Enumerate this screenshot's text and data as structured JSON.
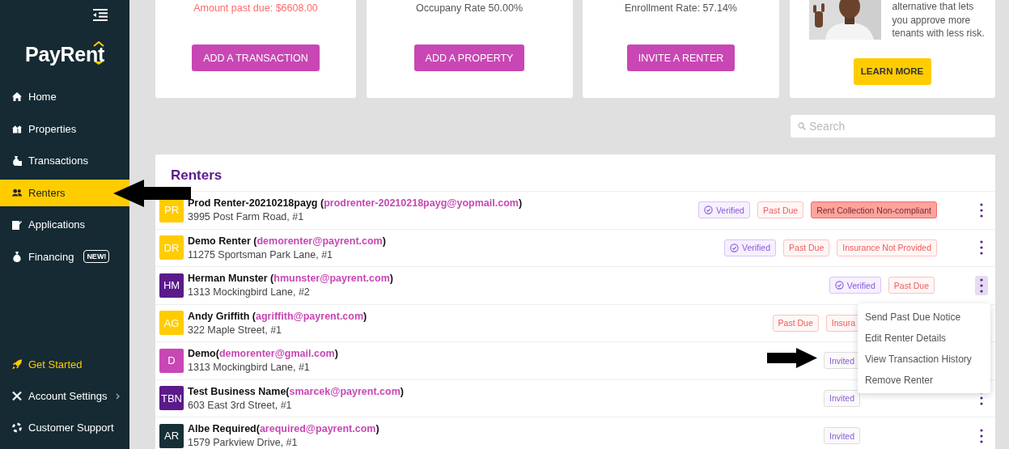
{
  "sidebar": {
    "logo": "PayRent",
    "items": [
      {
        "label": "Home",
        "selected": false
      },
      {
        "label": "Properties",
        "selected": false
      },
      {
        "label": "Transactions",
        "selected": false
      },
      {
        "label": "Renters",
        "selected": true
      },
      {
        "label": "Applications",
        "selected": false
      },
      {
        "label": "Financing",
        "selected": false,
        "badge": "NEW!"
      }
    ],
    "bottom_items": [
      {
        "label": "Get Started",
        "kind": "accent"
      },
      {
        "label": "Account Settings",
        "kind": "submenu"
      },
      {
        "label": "Customer Support",
        "kind": "plain"
      }
    ]
  },
  "cards": [
    {
      "kind": "stat",
      "text": "Amount past due: $6608.00",
      "alert": true,
      "button": "ADD A TRANSACTION"
    },
    {
      "kind": "stat",
      "text": "Occupany Rate 50.00%",
      "alert": false,
      "button": "ADD A PROPERTY"
    },
    {
      "kind": "stat",
      "text": "Enrollment Rate: 57.14%",
      "alert": false,
      "button": "INVITE A RENTER"
    },
    {
      "kind": "promo",
      "lines": [
        "alternative that lets",
        "you approve more",
        "tenants with less risk."
      ],
      "button": "LEARN MORE"
    }
  ],
  "search": {
    "placeholder": "Search"
  },
  "renters": {
    "title": "Renters",
    "rows": [
      {
        "initials": "PR",
        "color": "#ffcc00",
        "name": [
          {
            "kind": "text",
            "text": "Prod Renter-20210218payg ("
          },
          {
            "kind": "email",
            "text": "prodrenter-20210218payg@yopmail.com"
          },
          {
            "kind": "text",
            "text": ")"
          }
        ],
        "address": "3995 Post Farm Road, #1",
        "menu_open": false,
        "badges": [
          {
            "kind": "verified",
            "text": "Verified"
          },
          {
            "kind": "past_due",
            "text": "Past Due"
          },
          {
            "kind": "alert",
            "text": "Rent Collection Non-compliant"
          }
        ]
      },
      {
        "initials": "DR",
        "color": "#ffcc00",
        "name": [
          {
            "kind": "text",
            "text": "Demo Renter ("
          },
          {
            "kind": "email",
            "text": "demorenter@payrent.com"
          },
          {
            "kind": "text",
            "text": ")"
          }
        ],
        "address": "11275 Sportsman Park Lane, #1",
        "menu_open": false,
        "badges": [
          {
            "kind": "verified",
            "text": "Verified"
          },
          {
            "kind": "past_due",
            "text": "Past Due"
          },
          {
            "kind": "past_due",
            "text": "Insurance Not Provided"
          }
        ]
      },
      {
        "initials": "HM",
        "color": "#5b1a8a",
        "name": [
          {
            "kind": "text",
            "text": "Herman Munster ("
          },
          {
            "kind": "email",
            "text": "hmunster@payrent.com"
          },
          {
            "kind": "text",
            "text": ")"
          }
        ],
        "address": "1313 Mockingbird Lane, #2",
        "menu_open": true,
        "badges": [
          {
            "kind": "verified",
            "text": "Verified"
          },
          {
            "kind": "past_due",
            "text": "Past Due"
          }
        ]
      },
      {
        "initials": "AG",
        "color": "#ffcc00",
        "name": [
          {
            "kind": "text",
            "text": "Andy Griffith ("
          },
          {
            "kind": "email",
            "text": "agriffith@payrent.com"
          },
          {
            "kind": "text",
            "text": ")"
          }
        ],
        "address": "322 Maple Street, #1",
        "menu_open": false,
        "badges": [
          {
            "kind": "past_due",
            "text": "Past Due"
          },
          {
            "kind": "covered",
            "text": "Insura"
          }
        ]
      },
      {
        "initials": "D",
        "color": "#c847b4",
        "name": [
          {
            "kind": "text",
            "text": "Demo("
          },
          {
            "kind": "email",
            "text": "demorenter@gmail.com"
          },
          {
            "kind": "text",
            "text": ")"
          }
        ],
        "address": "1313 Mockingbird Lane, #1",
        "menu_open": false,
        "badges": [
          {
            "kind": "invited",
            "text": "Invited"
          }
        ]
      },
      {
        "initials": "TBN",
        "color": "#5b1a8a",
        "name": [
          {
            "kind": "text",
            "text": "Test Business Name("
          },
          {
            "kind": "email",
            "text": "smarcek@payrent.com"
          },
          {
            "kind": "text",
            "text": ")"
          }
        ],
        "address": "603 East 3rd Street, #1",
        "menu_open": false,
        "badges": [
          {
            "kind": "invited",
            "text": "Invited"
          }
        ]
      },
      {
        "initials": "AR",
        "color": "#173038",
        "name": [
          {
            "kind": "text",
            "text": "Albe Required("
          },
          {
            "kind": "email",
            "text": "arequired@payrent.com"
          },
          {
            "kind": "text",
            "text": ")"
          }
        ],
        "address": "1579 Parkview Drive, #1",
        "menu_open": false,
        "badges": [
          {
            "kind": "invited",
            "text": "Invited"
          }
        ]
      }
    ]
  },
  "row_menu": {
    "items": [
      "Send Past Due Notice",
      "Edit Renter Details",
      "View Transaction History",
      "Remove Renter"
    ]
  }
}
